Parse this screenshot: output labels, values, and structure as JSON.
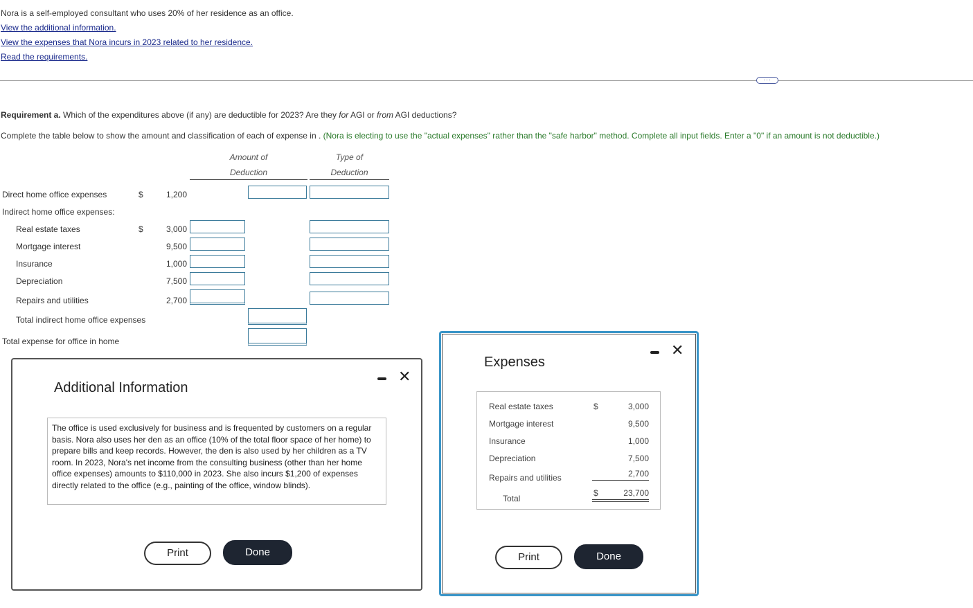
{
  "intro": {
    "statement": "Nora is a self-employed consultant who uses 20% of her residence as an office.",
    "links": [
      "View the additional information.",
      "View the expenses that Nora incurs in 2023 related to her residence.",
      "Read the requirements."
    ]
  },
  "more_button": "···",
  "requirement": {
    "label": "Requirement a.",
    "question_pre": " Which of the expenditures above (if any) are deductible for 2023? Are they ",
    "for_text": "for",
    "question_mid": " AGI or ",
    "from_text": "from",
    "question_post": " AGI deductions?"
  },
  "instruction": {
    "lead": "Complete the table below to show the amount and classification of each of expense in . ",
    "note": "(Nora is electing to use the \"actual expenses\" rather than the \"safe harbor\" method. Complete all input fields. Enter a \"0\" if an amount is not deductible.)"
  },
  "table": {
    "col_amount_line1": "Amount of",
    "col_amount_line2": "Deduction",
    "col_type_line1": "Type of",
    "col_type_line2": "Deduction",
    "direct": {
      "label": "Direct home office expenses",
      "dollar": "$",
      "value": "1,200"
    },
    "indirect_header": "Indirect home office expenses:",
    "rows": [
      {
        "label": "Real estate taxes",
        "dollar": "$",
        "value": "3,000"
      },
      {
        "label": "Mortgage interest",
        "dollar": "",
        "value": "9,500"
      },
      {
        "label": "Insurance",
        "dollar": "",
        "value": "1,000"
      },
      {
        "label": "Depreciation",
        "dollar": "",
        "value": "7,500"
      },
      {
        "label": "Repairs and utilities",
        "dollar": "",
        "value": "2,700"
      }
    ],
    "total_indirect_label": "Total indirect home office expenses",
    "total_label": "Total expense for office in home"
  },
  "additional_dialog": {
    "title": "Additional Information",
    "text": "The office is used exclusively for business and is frequented by customers on a regular basis. Nora also uses her den as an office (10% of the total floor space of her home) to prepare bills and keep records. However, the den is also used by her children as a TV room. In 2023, Nora's net income from the consulting business (other than her home office expenses) amounts to $110,000 in 2023. She also incurs $1,200 of expenses directly related to the office (e.g., painting of the office, window blinds).",
    "print_label": "Print",
    "done_label": "Done",
    "close_glyph": "✕"
  },
  "expenses_dialog": {
    "title": "Expenses",
    "rows": [
      {
        "label": "Real estate taxes",
        "dollar": "$",
        "value": "3,000"
      },
      {
        "label": "Mortgage interest",
        "dollar": "",
        "value": "9,500"
      },
      {
        "label": "Insurance",
        "dollar": "",
        "value": "1,000"
      },
      {
        "label": "Depreciation",
        "dollar": "",
        "value": "7,500"
      },
      {
        "label": "Repairs and utilities",
        "dollar": "",
        "value": "2,700"
      }
    ],
    "total_label": "Total",
    "total_dollar": "$",
    "total_value": "23,700",
    "print_label": "Print",
    "done_label": "Done",
    "close_glyph": "✕"
  },
  "colors": {
    "link": "#1a2a8c",
    "instruction_green": "#2a7a2a",
    "input_border": "#3a7a9a",
    "focus_ring": "#3a95c8",
    "done_button": "#1e2531"
  }
}
